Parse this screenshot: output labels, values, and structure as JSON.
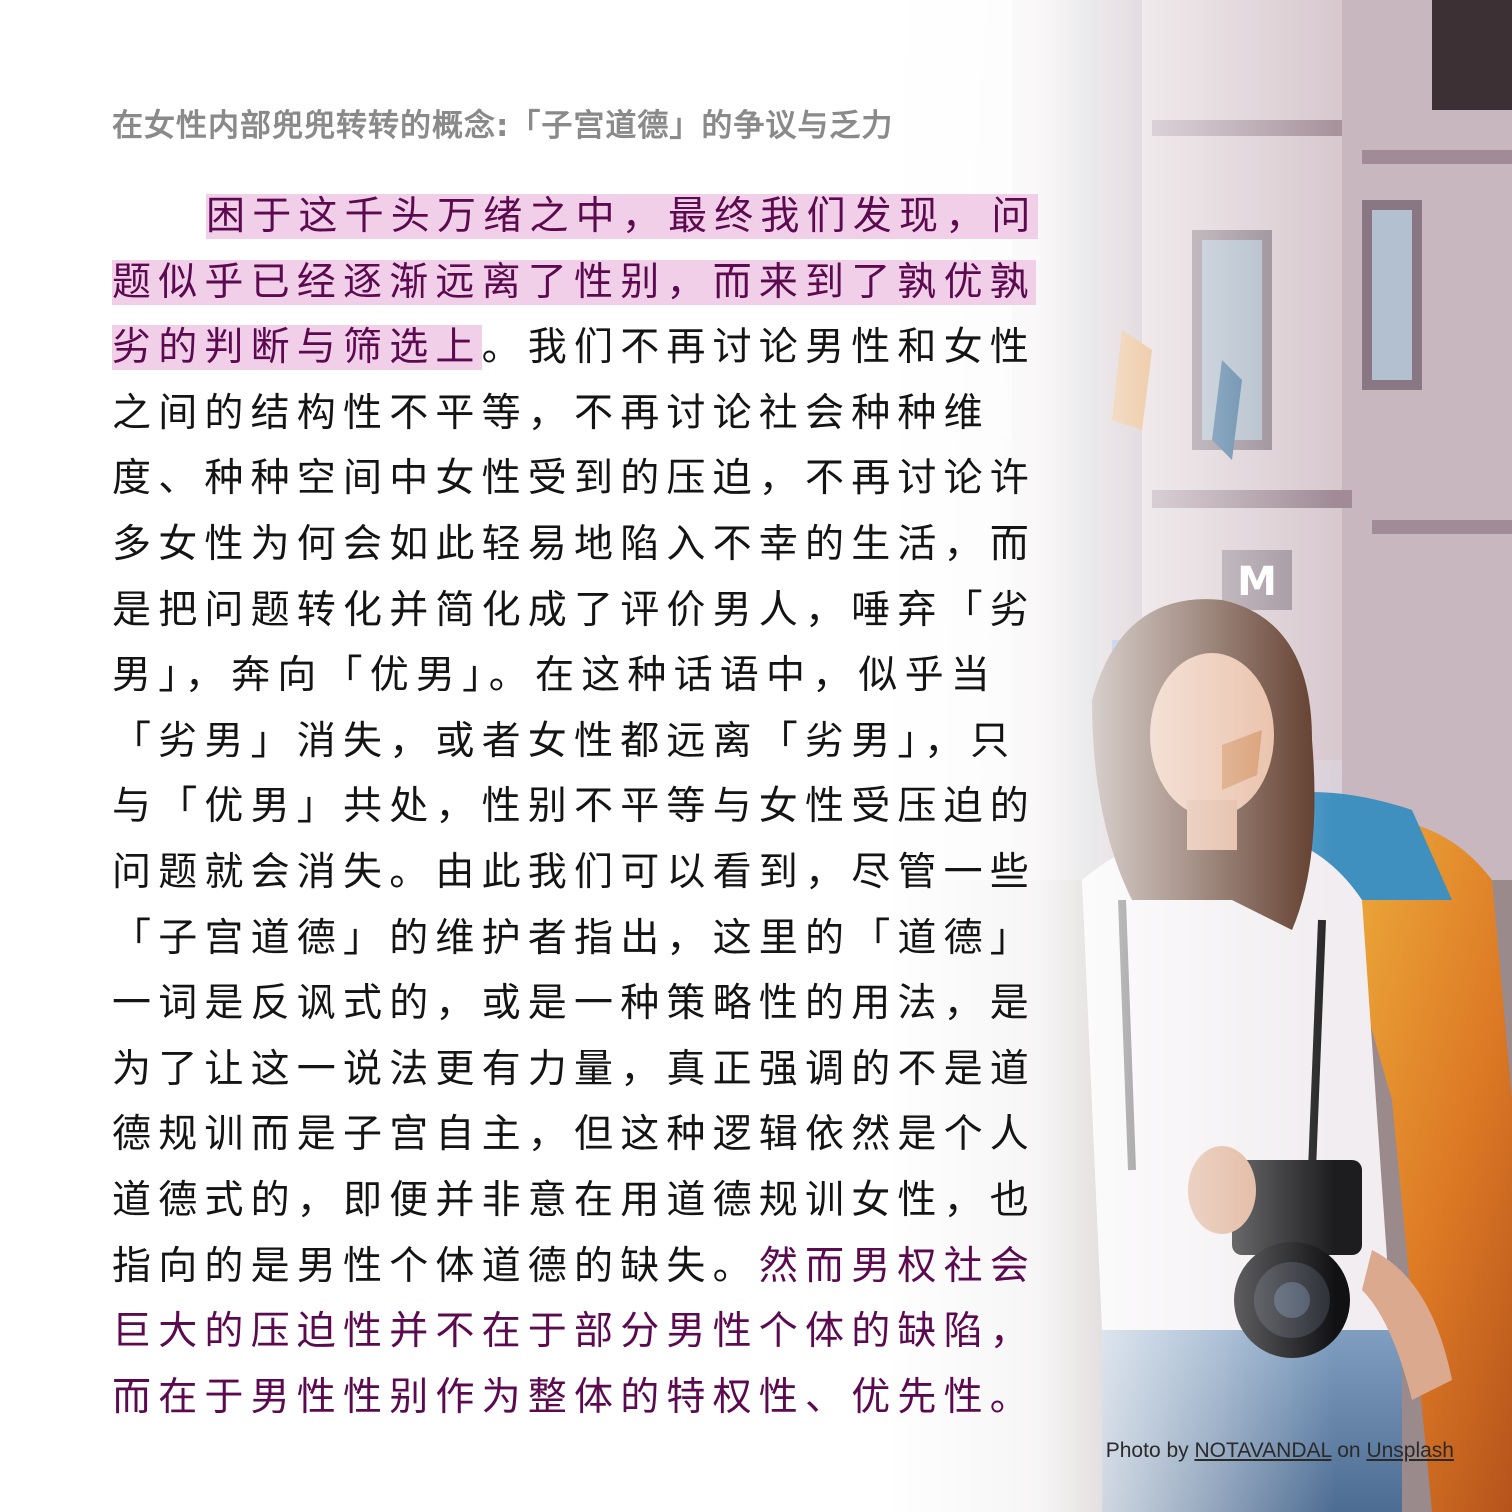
{
  "title": "在女性内部兜兜转转的概念:「子宫道德」的争议与乏力",
  "paragraph": {
    "highlight_1": "困于这千头万绪之中，最终我们发现，问题似乎已经逐渐远离了性别，而来到了孰优孰劣的判断与筛选上",
    "body": "。我们不再讨论男性和女性之间的结构性不平等，不再讨论社会种种维度、种种空间中女性受到的压迫，不再讨论许多女性为何会如此轻易地陷入不幸的生活，而是把问题转化并简化成了评价男人，唾弃「劣男」，奔向「优男」。在这种话语中，似乎当「劣男」消失，或者女性都远离「劣男」，只与「优男」共处，性别不平等与女性受压迫的问题就会消失。由此我们可以看到，尽管一些「子宫道德」的维护者指出，这里的「道德」一词是反讽式的，或是一种策略性的用法，是为了让这一说法更有力量，真正强调的不是道德规训而是子宫自主，但这种逻辑依然是个人道德式的，即便并非意在用道德规训女性，也指向的是男性个体道德的缺失。",
    "highlight_2": "然而男权社会巨大的压迫性并不在于部分男性个体的缺陷，而在于男性性别作为整体的特权性、优先性。"
  },
  "credit": {
    "prefix": "Photo by ",
    "author": "NOTAVANDAL",
    "middle": " on ",
    "site": "Unsplash"
  },
  "photo_sign": "M"
}
